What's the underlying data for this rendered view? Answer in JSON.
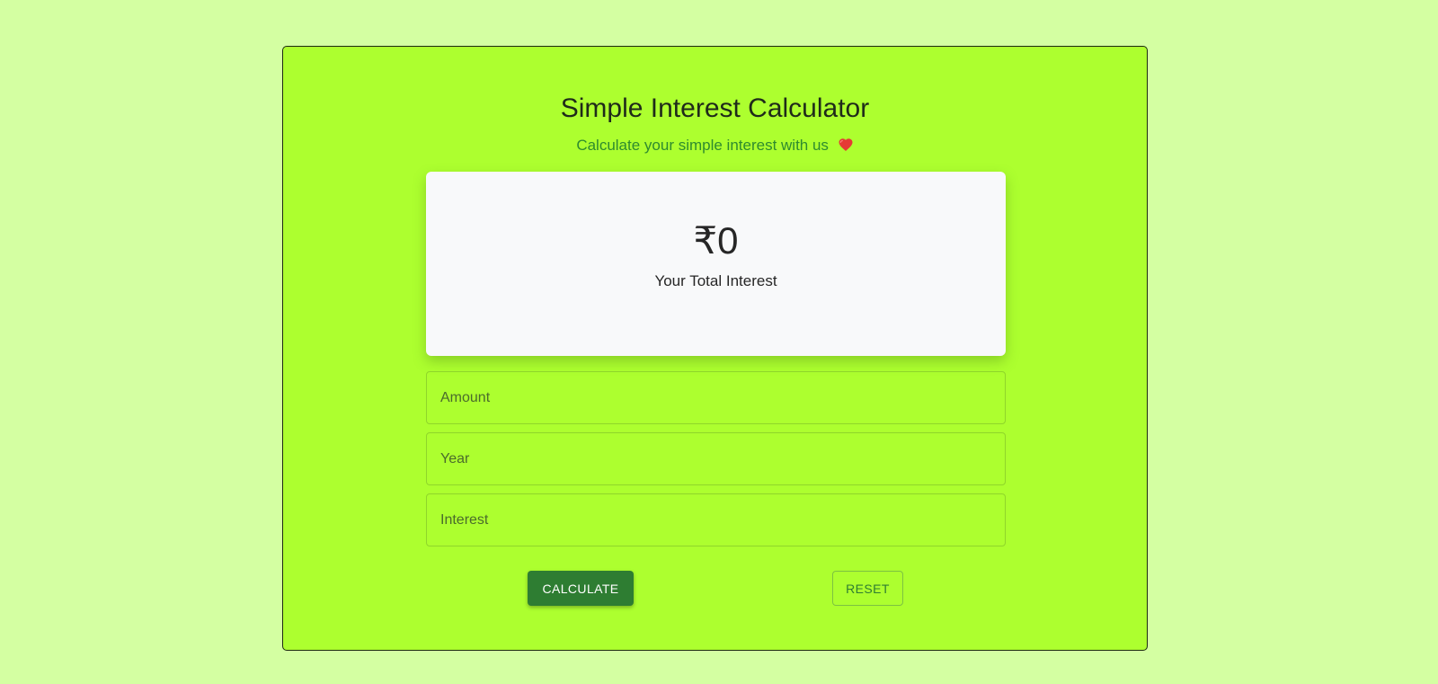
{
  "colors": {
    "page_background": "#d4ffa2",
    "card_background": "#adff2f",
    "accent_green": "#2e7d32",
    "subtitle_green": "#2e8b2e",
    "heart_red": "#e53935"
  },
  "header": {
    "title": "Simple Interest Calculator",
    "subtitle": "Calculate your simple interest with us",
    "subtitle_icon": "red-heart-icon"
  },
  "result": {
    "value": "₹0",
    "label": "Your Total Interest"
  },
  "form": {
    "amount": {
      "placeholder": "Amount",
      "value": ""
    },
    "year": {
      "placeholder": "Year",
      "value": ""
    },
    "interest": {
      "placeholder": "Interest",
      "value": ""
    }
  },
  "buttons": {
    "calculate": "CALCULATE",
    "reset": "RESET"
  }
}
